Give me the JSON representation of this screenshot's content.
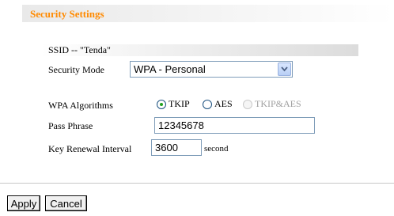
{
  "section": {
    "title": "Security Settings"
  },
  "ssid": {
    "text": "SSID -- \"Tenda\""
  },
  "security_mode": {
    "label": "Security Mode",
    "selected": "WPA - Personal",
    "dropdown_icon": "chevron-down-icon"
  },
  "wpa_algorithms": {
    "label": "WPA Algorithms",
    "options": [
      {
        "label": "TKIP",
        "checked": true,
        "disabled": false
      },
      {
        "label": "AES",
        "checked": false,
        "disabled": false
      },
      {
        "label": "TKIP&AES",
        "checked": false,
        "disabled": true
      }
    ]
  },
  "pass_phrase": {
    "label": "Pass Phrase",
    "value": "12345678"
  },
  "key_renewal": {
    "label": "Key Renewal Interval",
    "value": "3600",
    "unit": "second"
  },
  "buttons": {
    "apply": "Apply",
    "cancel": "Cancel"
  },
  "colors": {
    "title": "#ff8a00",
    "radio_checked": "#21a121",
    "input_border": "#7f9db9"
  }
}
